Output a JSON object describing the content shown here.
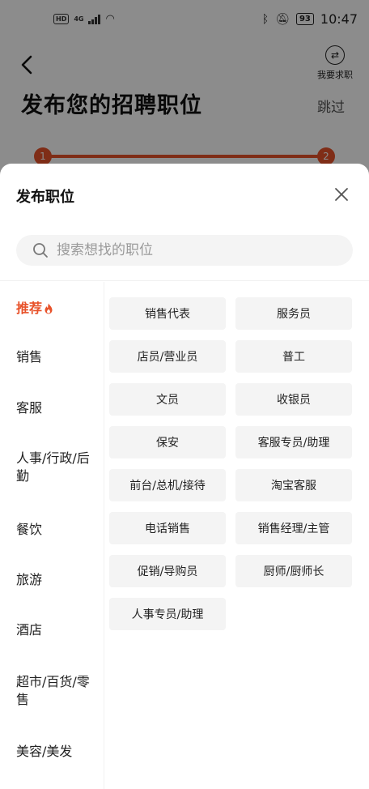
{
  "status_bar": {
    "hd": "HD",
    "network": "4G",
    "battery": "93",
    "time": "10:47"
  },
  "background": {
    "title": "发布您的招聘职位",
    "skip": "跳过",
    "switch_role": "我要求职",
    "steps": [
      "1",
      "2"
    ]
  },
  "sheet": {
    "title": "发布职位",
    "search_placeholder": "搜索想找的职位",
    "categories": [
      {
        "label": "推荐",
        "active": true
      },
      {
        "label": "销售"
      },
      {
        "label": "客服"
      },
      {
        "label": "人事/行政/后勤"
      },
      {
        "label": "餐饮"
      },
      {
        "label": "旅游"
      },
      {
        "label": "酒店"
      },
      {
        "label": "超市/百货/零售"
      },
      {
        "label": "美容/美发"
      }
    ],
    "positions": [
      "销售代表",
      "服务员",
      "店员/营业员",
      "普工",
      "文员",
      "收银员",
      "保安",
      "客服专员/助理",
      "前台/总机/接待",
      "淘宝客服",
      "电话销售",
      "销售经理/主管",
      "促销/导购员",
      "厨师/厨师长",
      "人事专员/助理"
    ],
    "accent_color": "#e8522a"
  }
}
